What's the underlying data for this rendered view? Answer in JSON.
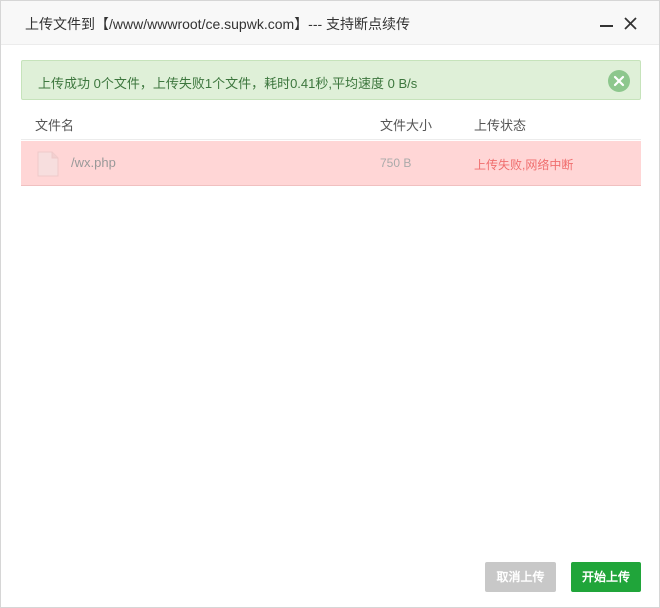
{
  "dialog": {
    "title": "上传文件到【/www/wwwroot/ce.supwk.com】--- 支持断点续传",
    "minimize_icon": "minimize-icon",
    "close_icon": "close-icon"
  },
  "alert": {
    "message": "上传成功 0个文件，上传失败1个文件，耗时0.41秒,平均速度 0 B/s",
    "close_icon": "circle-close-icon",
    "bg_color": "#dff0d8",
    "text_color": "#3c763d"
  },
  "table": {
    "headers": {
      "name": "文件名",
      "size": "文件大小",
      "status": "上传状态"
    },
    "rows": [
      {
        "icon": "file-icon",
        "name": "/wx.php",
        "size": "750 B",
        "status": "上传失败,网络中断",
        "status_color": "#f06e6e",
        "row_color": "#ffd6d6"
      }
    ]
  },
  "buttons": {
    "cancel": "取消上传",
    "start": "开始上传",
    "start_color": "#20a53a"
  }
}
